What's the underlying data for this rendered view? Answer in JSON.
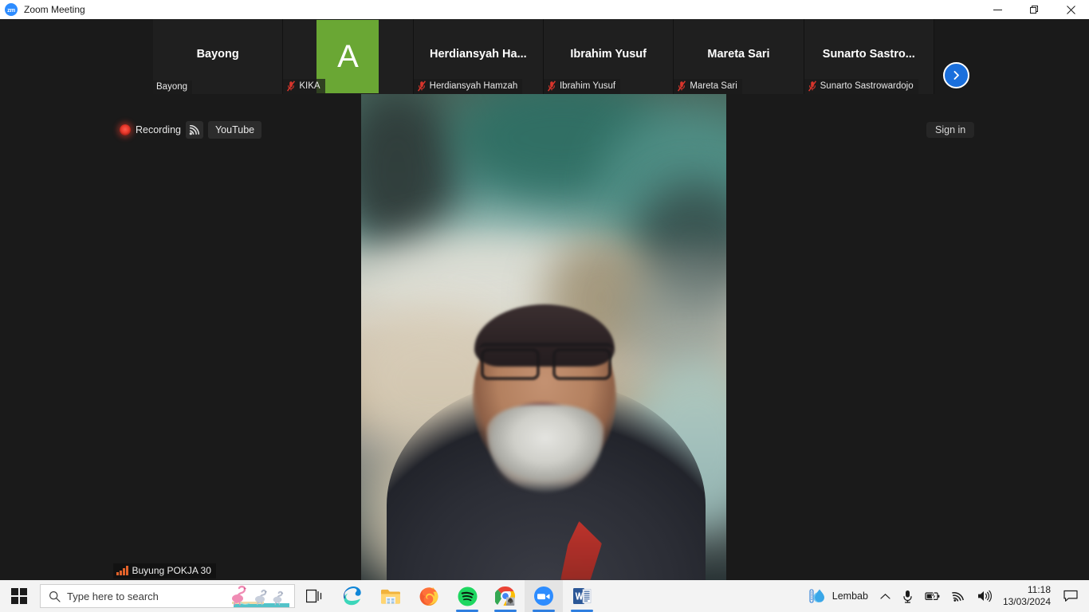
{
  "window": {
    "title": "Zoom Meeting",
    "app_icon": "zoom-icon",
    "app_icon_text": "zm",
    "minimize_label": "Minimize",
    "restore_label": "Restore",
    "close_label": "Close"
  },
  "filmstrip": {
    "participants": [
      {
        "display_name": "Bayong",
        "name_label": "Bayong",
        "muted": false,
        "video_on": false,
        "avatar_letter": "",
        "avatar_color": ""
      },
      {
        "display_name": "",
        "name_label": "KIKA",
        "muted": true,
        "video_on": false,
        "avatar_letter": "A",
        "avatar_color": "#6aa734"
      },
      {
        "display_name": "Herdiansyah  Ha...",
        "name_label": "Herdiansyah Hamzah",
        "muted": true,
        "video_on": false,
        "avatar_letter": "",
        "avatar_color": ""
      },
      {
        "display_name": "Ibrahim Yusuf",
        "name_label": "Ibrahim Yusuf",
        "muted": true,
        "video_on": false,
        "avatar_letter": "",
        "avatar_color": ""
      },
      {
        "display_name": "Mareta Sari",
        "name_label": "Mareta Sari",
        "muted": true,
        "video_on": false,
        "avatar_letter": "",
        "avatar_color": ""
      },
      {
        "display_name": "Sunarto  Sastro...",
        "name_label": "Sunarto Sastrowardojo",
        "muted": true,
        "video_on": false,
        "avatar_letter": "",
        "avatar_color": ""
      }
    ],
    "next_page_button": "next-page-arrow"
  },
  "recording": {
    "status_text": "Recording",
    "stream_icon": "live-stream-icon",
    "platform_label": "YouTube"
  },
  "sign_in": {
    "label": "Sign in"
  },
  "active_speaker": {
    "connection_label": "Buyung POKJA 30",
    "signal_icon": "signal-bars-icon"
  },
  "taskbar": {
    "start_label": "Start",
    "search": {
      "placeholder": "Type here to search",
      "value": "",
      "icon": "search-icon"
    },
    "task_view_label": "Task View",
    "apps": [
      {
        "name": "microsoft-edge",
        "label": "Microsoft Edge",
        "running": false
      },
      {
        "name": "file-explorer",
        "label": "File Explorer",
        "running": false
      },
      {
        "name": "mozilla-firefox",
        "label": "Mozilla Firefox",
        "running": false
      },
      {
        "name": "spotify",
        "label": "Spotify",
        "running": true
      },
      {
        "name": "google-chrome",
        "label": "Google Chrome",
        "running": true
      },
      {
        "name": "zoom",
        "label": "Zoom",
        "running": true
      },
      {
        "name": "microsoft-word",
        "label": "Microsoft Word",
        "running": true
      }
    ],
    "tray": {
      "weather_label": "Lembab",
      "weather_icon": "humidity-icon",
      "show_hidden_icons": "chevron-up-icon",
      "microphone_icon": "microphone-icon",
      "battery_icon": "battery-charging-icon",
      "network_icon": "wifi-icon",
      "volume_icon": "speaker-icon",
      "time": "11:18",
      "date": "13/03/2024",
      "notifications_icon": "notification-icon"
    }
  }
}
